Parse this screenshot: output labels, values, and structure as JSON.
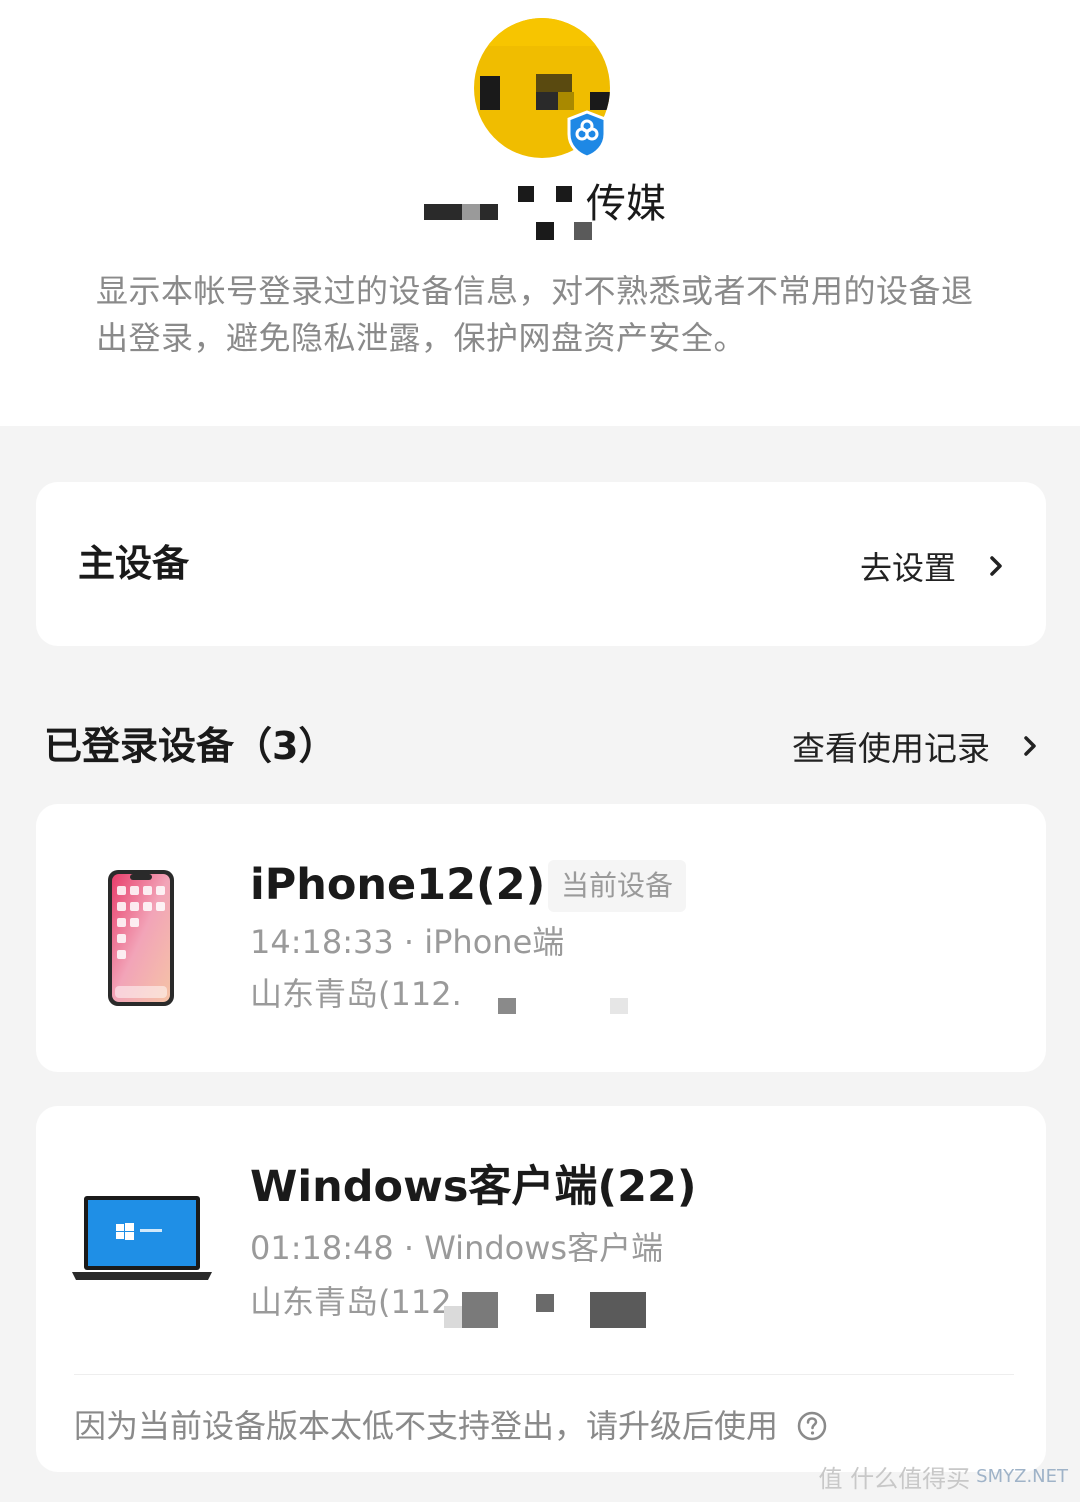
{
  "profile": {
    "name_suffix": "传媒",
    "description": "显示本帐号登录过的设备信息，对不熟悉或者不常用的设备退出登录，避免隐私泄露，保护网盘资产安全。"
  },
  "main_device": {
    "title": "主设备",
    "action_label": "去设置"
  },
  "logged_devices": {
    "title": "已登录设备（3）",
    "link_label": "查看使用记录",
    "items": [
      {
        "name": "iPhone12(2)",
        "badge": "当前设备",
        "time_line": "14:18:33 · iPhone端",
        "location_line": "山东青岛(112.",
        "icon": "iphone-icon"
      },
      {
        "name": "Windows客户端(22)",
        "time_line": "01:18:48 · Windows客户端",
        "location_line": "山东青岛(112",
        "icon": "laptop-icon",
        "note": "因为当前设备版本太低不支持登出，请升级后使用"
      }
    ]
  },
  "watermark": {
    "text": "值 什么值得买",
    "url": "SMYZ.NET"
  },
  "colors": {
    "avatar": "#f0bd00",
    "shield": "#1e88e5",
    "background": "#f4f4f4"
  }
}
